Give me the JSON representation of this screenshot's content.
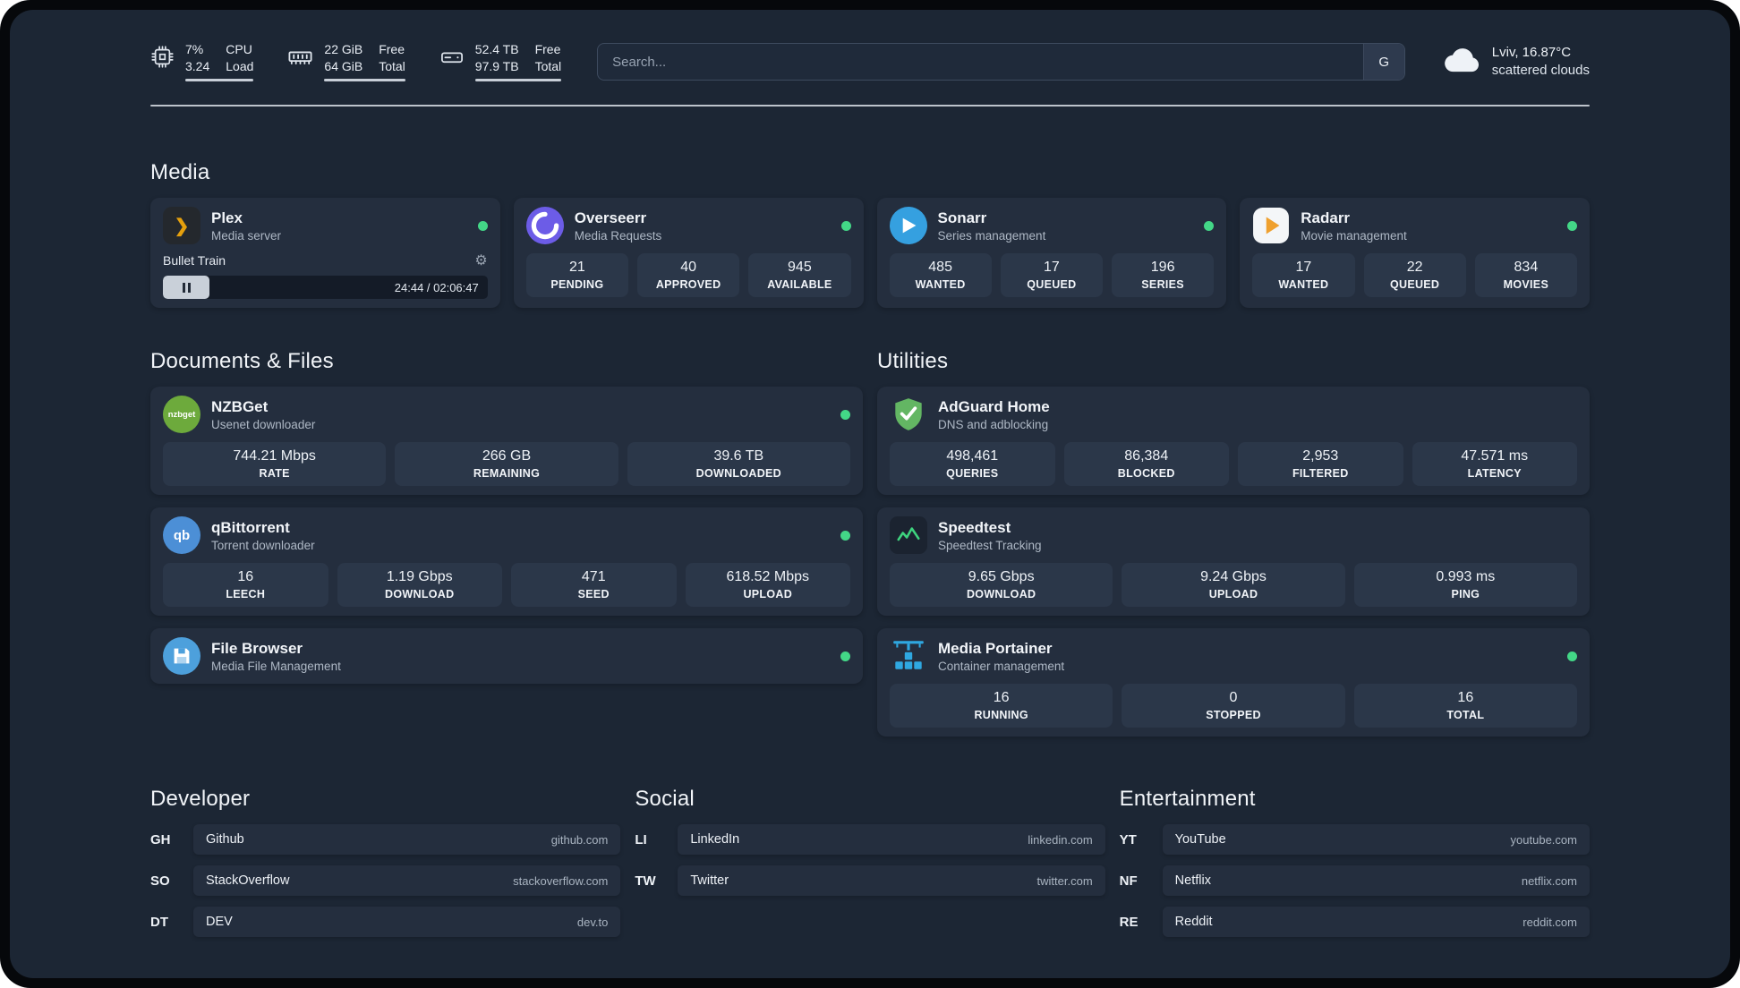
{
  "topbar": {
    "cpu": {
      "icon": "cpu-icon",
      "value_top": "7%",
      "value_bottom": "3.24",
      "label_top": "CPU",
      "label_bottom": "Load"
    },
    "memory": {
      "icon": "memory-icon",
      "value_top": "22 GiB",
      "value_bottom": "64 GiB",
      "label_top": "Free",
      "label_bottom": "Total"
    },
    "disk": {
      "icon": "disk-icon",
      "value_top": "52.4 TB",
      "value_bottom": "97.9 TB",
      "label_top": "Free",
      "label_bottom": "Total"
    },
    "search": {
      "placeholder": "Search...",
      "provider": "G"
    },
    "weather": {
      "icon": "cloud-icon",
      "location": "Lviv, 16.87°C",
      "condition": "scattered clouds"
    }
  },
  "media": {
    "title": "Media",
    "plex": {
      "icon": "plex-icon",
      "name": "Plex",
      "subtitle": "Media server",
      "status": "online",
      "now_playing": "Bullet Train",
      "time": "24:44 / 02:06:47"
    },
    "overseerr": {
      "icon": "overseerr-icon",
      "name": "Overseerr",
      "subtitle": "Media Requests",
      "status": "online",
      "stats": [
        {
          "value": "21",
          "label": "PENDING"
        },
        {
          "value": "40",
          "label": "APPROVED"
        },
        {
          "value": "945",
          "label": "AVAILABLE"
        }
      ]
    },
    "sonarr": {
      "icon": "sonarr-icon",
      "name": "Sonarr",
      "subtitle": "Series management",
      "status": "online",
      "stats": [
        {
          "value": "485",
          "label": "WANTED"
        },
        {
          "value": "17",
          "label": "QUEUED"
        },
        {
          "value": "196",
          "label": "SERIES"
        }
      ]
    },
    "radarr": {
      "icon": "radarr-icon",
      "name": "Radarr",
      "subtitle": "Movie management",
      "status": "online",
      "stats": [
        {
          "value": "17",
          "label": "WANTED"
        },
        {
          "value": "22",
          "label": "QUEUED"
        },
        {
          "value": "834",
          "label": "MOVIES"
        }
      ]
    }
  },
  "documents": {
    "title": "Documents & Files",
    "nzbget": {
      "icon": "nzbget-icon",
      "name": "NZBGet",
      "subtitle": "Usenet downloader",
      "status": "online",
      "stats": [
        {
          "value": "744.21 Mbps",
          "label": "RATE"
        },
        {
          "value": "266 GB",
          "label": "REMAINING"
        },
        {
          "value": "39.6 TB",
          "label": "DOWNLOADED"
        }
      ]
    },
    "qbittorrent": {
      "icon": "qbittorrent-icon",
      "name": "qBittorrent",
      "subtitle": "Torrent downloader",
      "status": "online",
      "stats": [
        {
          "value": "16",
          "label": "LEECH"
        },
        {
          "value": "1.19 Gbps",
          "label": "DOWNLOAD"
        },
        {
          "value": "471",
          "label": "SEED"
        },
        {
          "value": "618.52 Mbps",
          "label": "UPLOAD"
        }
      ]
    },
    "filebrowser": {
      "icon": "filebrowser-icon",
      "name": "File Browser",
      "subtitle": "Media File Management",
      "status": "online"
    }
  },
  "utilities": {
    "title": "Utilities",
    "adguard": {
      "icon": "adguard-icon",
      "name": "AdGuard Home",
      "subtitle": "DNS and adblocking",
      "stats": [
        {
          "value": "498,461",
          "label": "QUERIES"
        },
        {
          "value": "86,384",
          "label": "BLOCKED"
        },
        {
          "value": "2,953",
          "label": "FILTERED"
        },
        {
          "value": "47.571 ms",
          "label": "LATENCY"
        }
      ]
    },
    "speedtest": {
      "icon": "speedtest-icon",
      "name": "Speedtest",
      "subtitle": "Speedtest Tracking",
      "stats": [
        {
          "value": "9.65 Gbps",
          "label": "DOWNLOAD"
        },
        {
          "value": "9.24 Gbps",
          "label": "UPLOAD"
        },
        {
          "value": "0.993 ms",
          "label": "PING"
        }
      ]
    },
    "portainer": {
      "icon": "portainer-icon",
      "name": "Media Portainer",
      "subtitle": "Container management",
      "status": "online",
      "stats": [
        {
          "value": "16",
          "label": "RUNNING"
        },
        {
          "value": "0",
          "label": "STOPPED"
        },
        {
          "value": "16",
          "label": "TOTAL"
        }
      ]
    }
  },
  "bookmarks": {
    "developer": {
      "title": "Developer",
      "items": [
        {
          "abbr": "GH",
          "name": "Github",
          "url": "github.com"
        },
        {
          "abbr": "SO",
          "name": "StackOverflow",
          "url": "stackoverflow.com"
        },
        {
          "abbr": "DT",
          "name": "DEV",
          "url": "dev.to"
        }
      ]
    },
    "social": {
      "title": "Social",
      "items": [
        {
          "abbr": "LI",
          "name": "LinkedIn",
          "url": "linkedin.com"
        },
        {
          "abbr": "TW",
          "name": "Twitter",
          "url": "twitter.com"
        }
      ]
    },
    "entertainment": {
      "title": "Entertainment",
      "items": [
        {
          "abbr": "YT",
          "name": "YouTube",
          "url": "youtube.com"
        },
        {
          "abbr": "NF",
          "name": "Netflix",
          "url": "netflix.com"
        },
        {
          "abbr": "RE",
          "name": "Reddit",
          "url": "reddit.com"
        }
      ]
    }
  },
  "colors": {
    "background": "#1c2634",
    "card": "#242e3e",
    "stat_box": "#2b3749",
    "status_green": "#43d787",
    "plex_amber": "#e5a00d",
    "accent_blue": "#35a0e0"
  }
}
